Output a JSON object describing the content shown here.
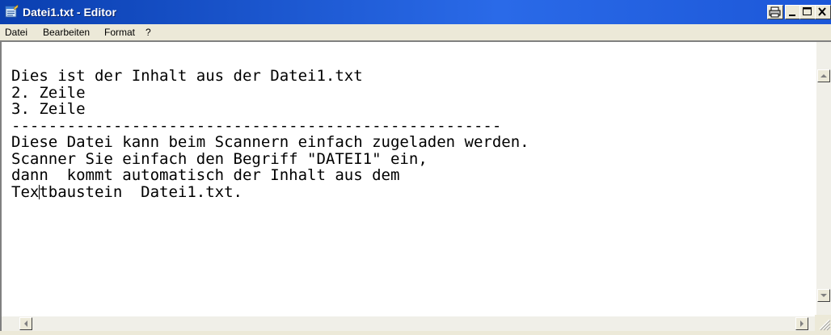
{
  "window": {
    "title": "Datei1.txt - Editor",
    "icon": "notepad-icon",
    "controls": [
      "print-icon",
      "minimize-icon",
      "maximize-icon",
      "close-icon"
    ]
  },
  "menu": {
    "items": [
      "Datei",
      "Bearbeiten",
      "Format",
      "?"
    ]
  },
  "document": {
    "lines": [
      "Dies ist der Inhalt aus der Datei1.txt",
      "2. Zeile",
      "3. Zeile",
      "-----------------------------------------------------",
      "Diese Datei kann beim Scannern einfach zugeladen werden.",
      "Scanner Sie einfach den Begriff \"DATEI1\" ein,",
      "dann  kommt automatisch der Inhalt aus dem"
    ],
    "last_line_before_caret": "Tex",
    "last_line_after_caret": "tbaustein  Datei1.txt."
  },
  "colors": {
    "titlebar": "#0a53d6",
    "chrome": "#ece9d8",
    "editor_bg": "#ffffff",
    "text": "#000000"
  }
}
